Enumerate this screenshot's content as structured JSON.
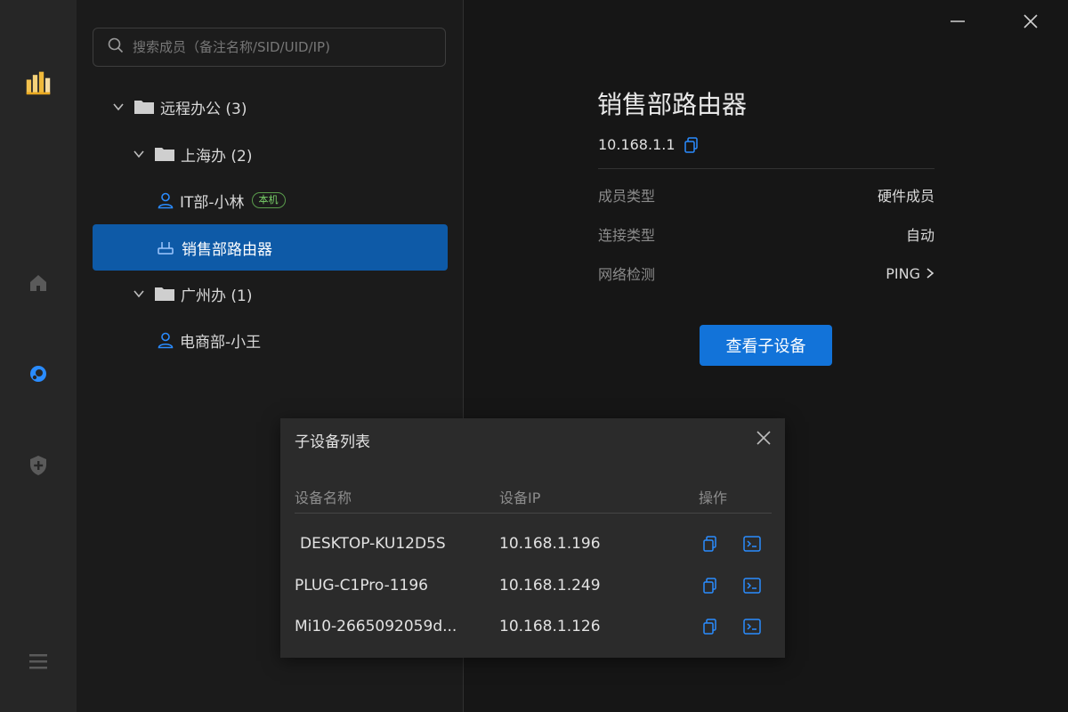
{
  "colors": {
    "accent": "#1273d9",
    "selected_row": "#0e5aa7",
    "badge_green": "#7bd36a",
    "icon_blue": "#2a8cff"
  },
  "rail": {
    "icons": [
      "logo-icon",
      "home-icon",
      "network-icon",
      "shield-plus-icon",
      "menu-icon"
    ]
  },
  "search": {
    "placeholder": "搜索成员（备注名称/SID/UID/IP)"
  },
  "tree": {
    "group_remote": "远程办公 (3)",
    "group_shanghai": "上海办 (2)",
    "member_it": "IT部-小林",
    "badge_local": "本机",
    "member_router": "销售部路由器",
    "group_guangzhou": "广州办 (1)",
    "member_ecom": "电商部-小王"
  },
  "detail": {
    "title": "销售部路由器",
    "ip": "10.168.1.1",
    "props": [
      {
        "key": "成员类型",
        "value": "硬件成员"
      },
      {
        "key": "连接类型",
        "value": "自动"
      },
      {
        "key": "网络检测",
        "value": "PING"
      }
    ],
    "view_button": "查看子设备"
  },
  "dialog": {
    "title": "子设备列表",
    "headers": {
      "name": "设备名称",
      "ip": "设备IP",
      "action": "操作"
    },
    "rows": [
      {
        "name": "DESKTOP-KU12D5S",
        "ip": "10.168.1.196"
      },
      {
        "name": "PLUG-C1Pro-1196",
        "ip": "10.168.1.249"
      },
      {
        "name": "Mi10-2665092059d...",
        "ip": "10.168.1.126"
      }
    ]
  }
}
